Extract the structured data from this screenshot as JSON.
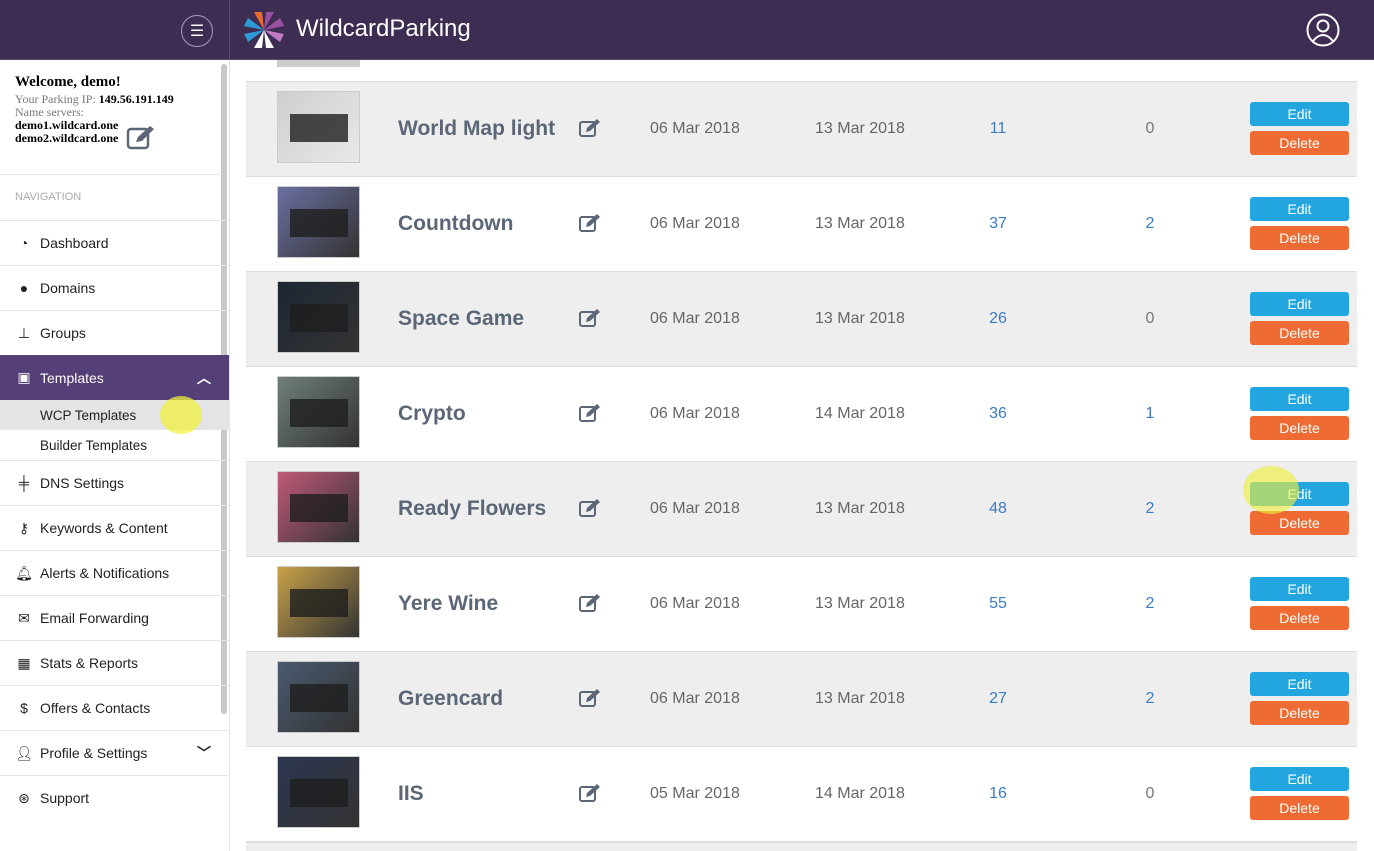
{
  "header": {
    "brand": "WildcardParking",
    "menu_icon": "hamburger-icon",
    "user_icon": "user-circle-icon"
  },
  "sidebar": {
    "welcome": "Welcome, demo!",
    "ip_label": "Your Parking IP:",
    "ip": "149.56.191.149",
    "ns_label": "Name servers:",
    "ns1": "demo1.wildcard.one",
    "ns2": "demo2.wildcard.one",
    "nav_label": "NAVIGATION",
    "items": [
      {
        "label": "Dashboard",
        "icon": "dashboard-icon"
      },
      {
        "label": "Domains",
        "icon": "globe-icon"
      },
      {
        "label": "Groups",
        "icon": "sitemap-icon"
      },
      {
        "label": "Templates",
        "icon": "briefcase-icon"
      },
      {
        "label": "DNS Settings",
        "icon": "signpost-icon"
      },
      {
        "label": "Keywords & Content",
        "icon": "key-icon"
      },
      {
        "label": "Alerts & Notifications",
        "icon": "bell-icon"
      },
      {
        "label": "Email Forwarding",
        "icon": "envelope-icon"
      },
      {
        "label": "Stats & Reports",
        "icon": "table-icon"
      },
      {
        "label": "Offers & Contacts",
        "icon": "dollar-icon"
      },
      {
        "label": "Profile & Settings",
        "icon": "user-icon"
      },
      {
        "label": "Support",
        "icon": "lifebuoy-icon"
      }
    ],
    "sub": [
      "WCP Templates",
      "Builder Templates"
    ]
  },
  "actions": {
    "edit": "Edit",
    "delete": "Delete"
  },
  "rows": [
    {
      "name": "World Map light",
      "created": "06 Mar 2018",
      "updated": "13 Mar 2018",
      "count1": "11",
      "count2": "0",
      "thumb_color": "#cfcfcf"
    },
    {
      "name": "Countdown",
      "created": "06 Mar 2018",
      "updated": "13 Mar 2018",
      "count1": "37",
      "count2": "2",
      "thumb_color": "#6a6fa0"
    },
    {
      "name": "Space Game",
      "created": "06 Mar 2018",
      "updated": "13 Mar 2018",
      "count1": "26",
      "count2": "0",
      "thumb_color": "#1d2733"
    },
    {
      "name": "Crypto",
      "created": "06 Mar 2018",
      "updated": "14 Mar 2018",
      "count1": "36",
      "count2": "1",
      "thumb_color": "#6f7f78"
    },
    {
      "name": "Ready Flowers",
      "created": "06 Mar 2018",
      "updated": "13 Mar 2018",
      "count1": "48",
      "count2": "2",
      "thumb_color": "#c05a78"
    },
    {
      "name": "Yere Wine",
      "created": "06 Mar 2018",
      "updated": "13 Mar 2018",
      "count1": "55",
      "count2": "2",
      "thumb_color": "#c9a24a"
    },
    {
      "name": "Greencard",
      "created": "06 Mar 2018",
      "updated": "13 Mar 2018",
      "count1": "27",
      "count2": "2",
      "thumb_color": "#4a5a70"
    },
    {
      "name": "IIS",
      "created": "05 Mar 2018",
      "updated": "14 Mar 2018",
      "count1": "16",
      "count2": "0",
      "thumb_color": "#2c3550"
    }
  ]
}
